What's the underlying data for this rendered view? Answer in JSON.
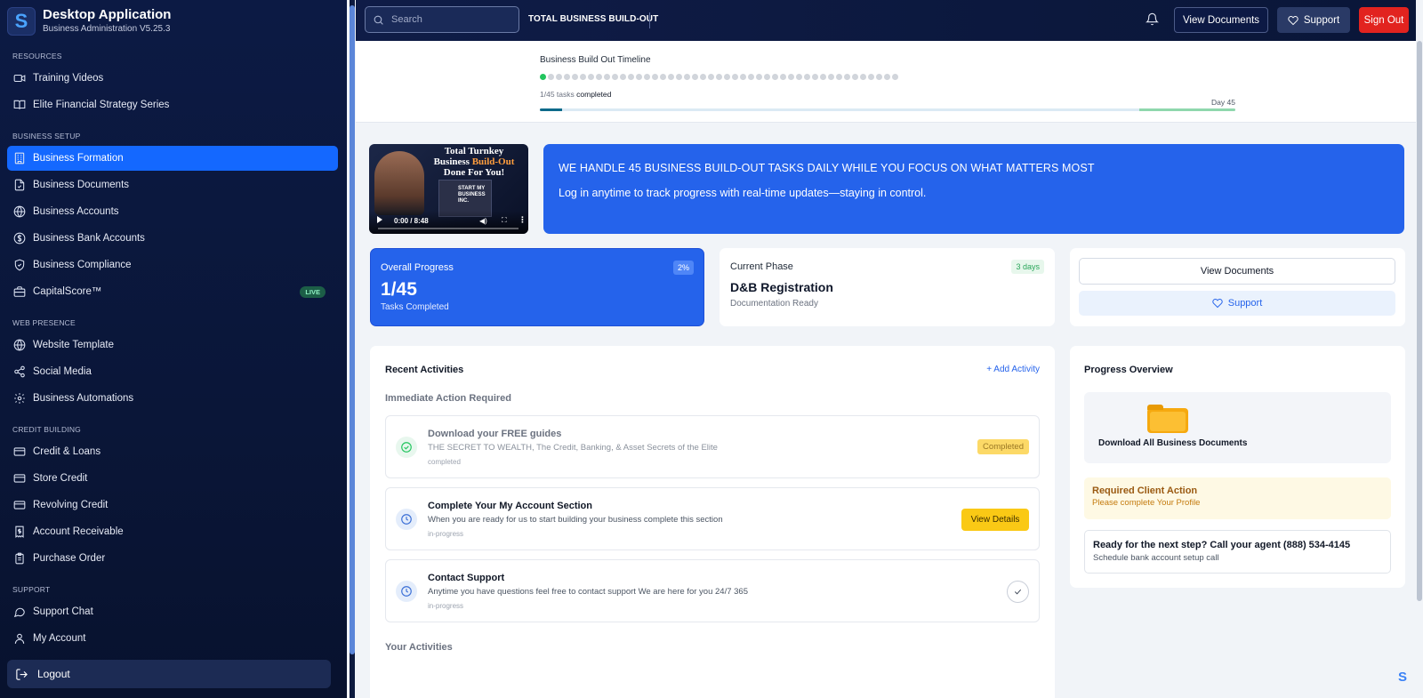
{
  "app": {
    "title": "Desktop Application",
    "subtitle": "Business Administration V5.25.3",
    "logo_letter": "S"
  },
  "sidebar": {
    "sections": [
      {
        "label": "RESOURCES"
      },
      {
        "label": "BUSINESS SETUP"
      },
      {
        "label": "WEB PRESENCE"
      },
      {
        "label": "CREDIT BUILDING"
      },
      {
        "label": "SUPPORT"
      }
    ],
    "items": [
      {
        "label": "Training Videos",
        "icon": "video-icon"
      },
      {
        "label": "Elite Financial Strategy Series",
        "icon": "book-icon"
      },
      {
        "label": "Business Formation",
        "icon": "building-icon",
        "active": true
      },
      {
        "label": "Business Documents",
        "icon": "file-icon"
      },
      {
        "label": "Business Accounts",
        "icon": "globe-icon"
      },
      {
        "label": "Business Bank Accounts",
        "icon": "dollar-icon"
      },
      {
        "label": "Business Compliance",
        "icon": "shield-icon"
      },
      {
        "label": "CapitalScore™",
        "icon": "briefcase-icon",
        "badge": "LIVE"
      },
      {
        "label": "Website Template",
        "icon": "globe-icon"
      },
      {
        "label": "Social Media",
        "icon": "share-icon"
      },
      {
        "label": "Business Automations",
        "icon": "gear-icon"
      },
      {
        "label": "Credit & Loans",
        "icon": "card-icon"
      },
      {
        "label": "Store Credit",
        "icon": "card-icon"
      },
      {
        "label": "Revolving Credit",
        "icon": "card-icon"
      },
      {
        "label": "Account Receivable",
        "icon": "receipt-icon"
      },
      {
        "label": "Purchase Order",
        "icon": "clipboard-icon"
      },
      {
        "label": "Support Chat",
        "icon": "chat-icon"
      },
      {
        "label": "My Account",
        "icon": "user-icon"
      }
    ],
    "logout_label": "Logout"
  },
  "topbar": {
    "search_placeholder": "Search",
    "title": "TOTAL BUSINESS BUILD-OUT",
    "view_documents": "View Documents",
    "support": "Support",
    "sign_out": "Sign Out"
  },
  "timeline": {
    "title": "Business Build Out Timeline",
    "total_tasks": 45,
    "completed_tasks": 1,
    "count_prefix": "1/45",
    "count_mid": "tasks",
    "count_suffix": "completed",
    "day_label": "Day 45"
  },
  "video": {
    "title_line1": "Total Turnkey",
    "title_line2a": "Business ",
    "title_line2b": "Build-Out",
    "title_line3": "Done For You!",
    "inset_text": "START MY BUSINESS INC.",
    "time": "0:00 / 8:48"
  },
  "banner": {
    "headline": "WE HANDLE 45 BUSINESS BUILD-OUT TASKS DAILY WHILE YOU FOCUS ON WHAT MATTERS MOST",
    "text": "Log in anytime to track progress with real-time updates—staying in control."
  },
  "stats": {
    "overall": {
      "label": "Overall Progress",
      "value": "1/45",
      "sub": "Tasks Completed",
      "badge": "2%"
    },
    "phase": {
      "label": "Current Phase",
      "value": "D&B Registration",
      "sub": "Documentation Ready",
      "badge": "3 days"
    },
    "actions": {
      "view_documents": "View Documents",
      "support": "Support"
    }
  },
  "recent": {
    "title": "Recent Activities",
    "add_label": "+ Add Activity",
    "immediate_label": "Immediate Action Required",
    "your_label": "Your Activities",
    "activities": [
      {
        "title": "Download your FREE guides",
        "desc": "THE SECRET TO WEALTH, The Credit, Banking, & Asset Secrets of the Elite",
        "status": "completed",
        "action": "Completed"
      },
      {
        "title": "Complete Your My Account Section",
        "desc": "When you are ready for us to start building your business complete this section",
        "status": "in-progress",
        "action": "View Details"
      },
      {
        "title": "Contact Support",
        "desc": "Anytime you have questions feel free to contact support We are here for you 24/7 365",
        "status": "in-progress",
        "action": ""
      }
    ]
  },
  "overview": {
    "title": "Progress Overview",
    "download_label": "Download All Business Documents",
    "required_title": "Required Client Action",
    "required_sub": "Please complete Your Profile",
    "next_title": "Ready for the next step? Call your agent (888) 534-4145",
    "next_sub": "Schedule bank account setup call"
  },
  "colors": {
    "sidebar_bg": "#0c1a44",
    "accent_blue": "#2563eb",
    "active_nav": "#1468ff",
    "sign_out_red": "#e2231f",
    "done_green": "#22c55e",
    "action_yellow": "#fac915"
  }
}
